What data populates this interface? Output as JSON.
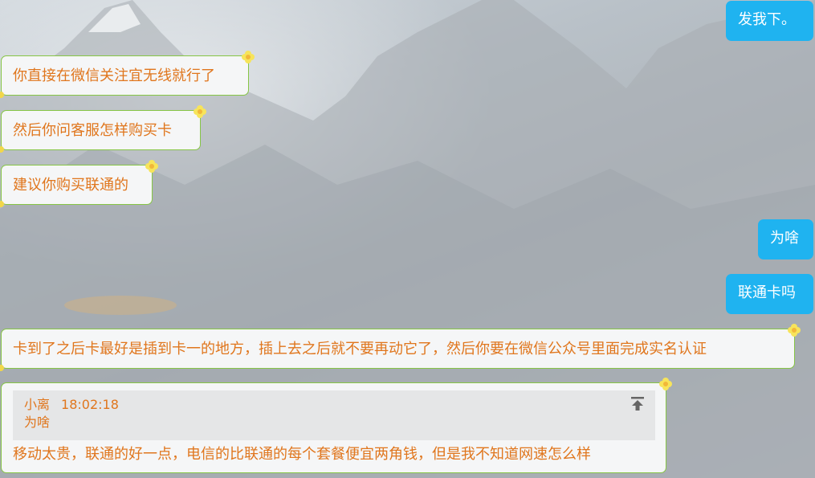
{
  "messages": {
    "send_me": "发我下。",
    "follow_wechat": "你直接在微信关注宜无线就行了",
    "ask_service": "然后你问客服怎样购买卡",
    "suggest_unicom": "建议你购买联通的",
    "why": "为啥",
    "unicom_card_q": "联通卡吗",
    "card_instructions": "卡到了之后卡最好是插到卡一的地方，插上去之后就不要再动它了，然后你要在微信公众号里面完成实名认证",
    "quote_sender": "小离",
    "quote_time": "18:02:18",
    "quote_text": "为啥",
    "reply_text": "移动太贵，联通的好一点，电信的比联通的每个套餐便宜两角钱，但是我不知道网速怎么样"
  },
  "icons": {
    "pin": "pin-to-top-icon",
    "decoration": "flower-icon"
  },
  "colors": {
    "own_bubble": "#1fb3f0",
    "other_text": "#e0761d",
    "other_border": "#86c545",
    "other_bubble": "#f5f6f7"
  }
}
